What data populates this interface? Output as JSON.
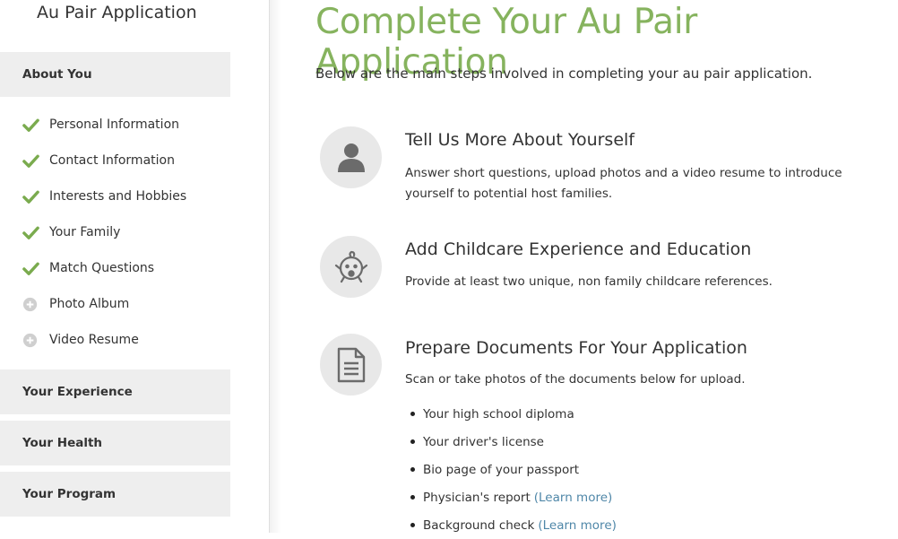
{
  "sidebar": {
    "app_title": "Au Pair Application",
    "sections": {
      "about_you": "About You",
      "your_experience": "Your Experience",
      "your_health": "Your Health",
      "your_program": "Your Program"
    },
    "steps": [
      {
        "label": "Personal Information",
        "status": "complete",
        "icon": "check-icon"
      },
      {
        "label": "Contact Information",
        "status": "complete",
        "icon": "check-icon"
      },
      {
        "label": "Interests and Hobbies",
        "status": "complete",
        "icon": "check-icon"
      },
      {
        "label": "Your Family",
        "status": "complete",
        "icon": "check-icon"
      },
      {
        "label": "Match Questions",
        "status": "complete",
        "icon": "check-icon"
      },
      {
        "label": "Photo Album",
        "status": "incomplete",
        "icon": "plus-circle-icon"
      },
      {
        "label": "Video Resume",
        "status": "incomplete",
        "icon": "plus-circle-icon"
      }
    ]
  },
  "main": {
    "title": "Complete Your Au Pair Application",
    "intro": "Below are the main steps involved in completing your au pair application.",
    "items": [
      {
        "icon": "person-icon",
        "title": "Tell Us More About Yourself",
        "description": "Answer short questions, upload photos and a video resume to introduce yourself to potential host families."
      },
      {
        "icon": "baby-icon",
        "title": "Add Childcare Experience and Education",
        "description": "Provide at least two unique, non family childcare references."
      },
      {
        "icon": "document-icon",
        "title": "Prepare Documents For Your Application",
        "description": "Scan or take photos of the documents below for upload."
      }
    ],
    "documents": [
      {
        "text": "Your high school diploma",
        "link": ""
      },
      {
        "text": "Your driver's license",
        "link": ""
      },
      {
        "text": "Bio page of your passport",
        "link": ""
      },
      {
        "text": "Physician's report",
        "link": "(Learn more)"
      },
      {
        "text": "Background check",
        "link": "(Learn more)"
      }
    ]
  },
  "colors": {
    "accent_green": "#86b35e",
    "check_green": "#7aab4e",
    "link_blue": "#4f87a8",
    "section_bg": "#eeeeee",
    "icon_circle_bg": "#e8e8e8",
    "icon_grey": "#6b6b6b"
  }
}
